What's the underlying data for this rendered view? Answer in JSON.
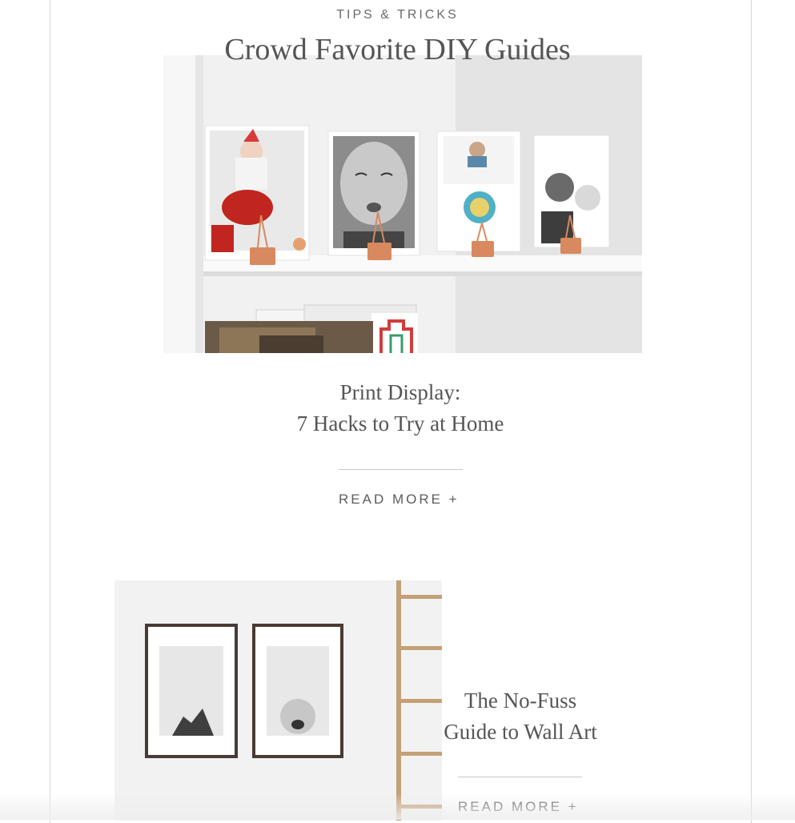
{
  "section": {
    "eyebrow": "TIPS & TRICKS",
    "title": "Crowd Favorite DIY Guides"
  },
  "articles": [
    {
      "title_line1": "Print Display:",
      "title_line2": "7 Hacks to Try at Home",
      "read_more": "READ MORE +"
    },
    {
      "title_line1": "The No-Fuss",
      "title_line2": "Guide to Wall Art",
      "read_more": "READ MORE +"
    }
  ],
  "colors": {
    "accent_copper": "#d8895f",
    "frame_wood": "#4a3a33",
    "ladder_wood": "#c4a077"
  }
}
